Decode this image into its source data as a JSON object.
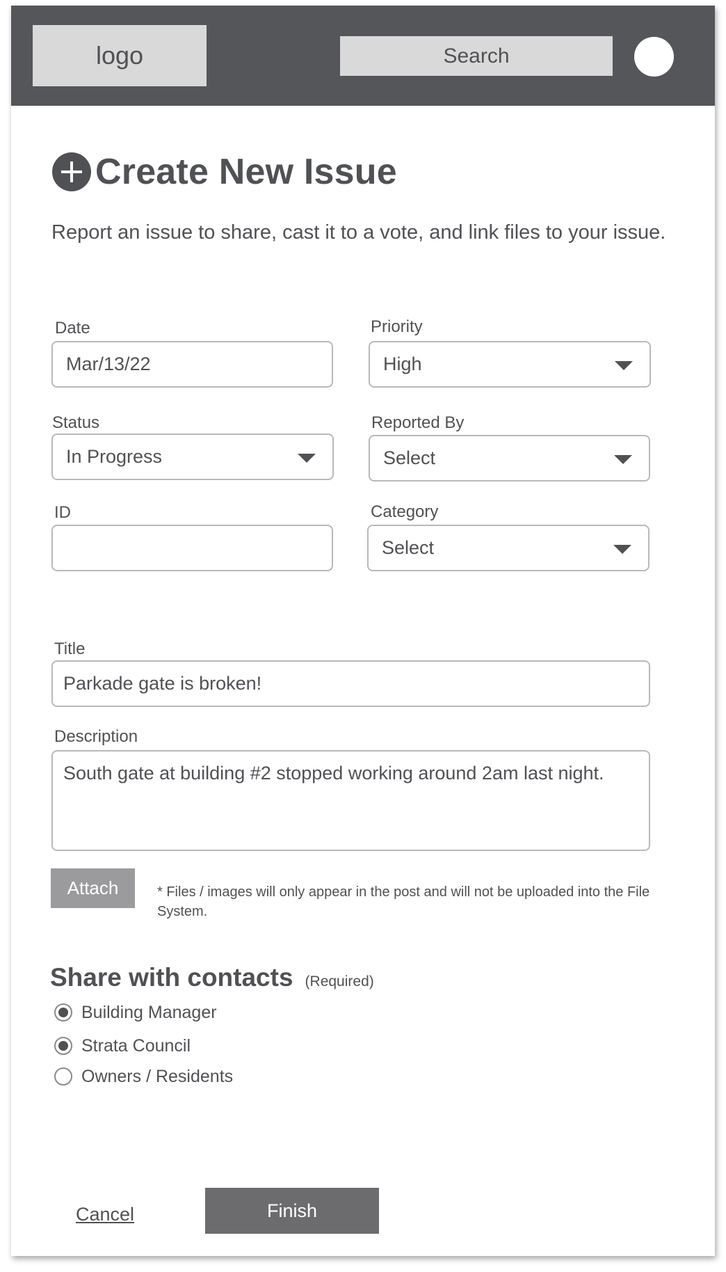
{
  "header": {
    "logo_text": "logo",
    "search_label": "Search"
  },
  "page": {
    "title": "Create New Issue",
    "subtitle": "Report an issue to share, cast it to a vote, and link files to your issue."
  },
  "form": {
    "date": {
      "label": "Date",
      "value": "Mar/13/22"
    },
    "priority": {
      "label": "Priority",
      "value": "High"
    },
    "status": {
      "label": "Status",
      "value": "In Progress"
    },
    "reported_by": {
      "label": "Reported By",
      "value": "Select"
    },
    "id": {
      "label": "ID",
      "value": ""
    },
    "category": {
      "label": "Category",
      "value": "Select"
    },
    "title": {
      "label": "Title",
      "value": "Parkade gate is broken!"
    },
    "description": {
      "label": "Description",
      "value": "South gate at building #2 stopped working around 2am last night."
    }
  },
  "attach": {
    "button_label": "Attach",
    "note": "* Files / images will only appear in the post and will not be uploaded into the File System."
  },
  "share": {
    "heading": "Share with contacts",
    "required_label": "(Required)",
    "options": [
      {
        "label": "Building Manager",
        "checked": true
      },
      {
        "label": "Strata Council",
        "checked": true
      },
      {
        "label": "Owners / Residents",
        "checked": false
      }
    ]
  },
  "actions": {
    "cancel_label": "Cancel",
    "finish_label": "Finish"
  },
  "colors": {
    "header_bg": "#55565a",
    "text": "#505154",
    "placeholder_block": "#d9d9d9",
    "attach_bg": "#9b9b9d",
    "finish_bg": "#6c6c6f",
    "field_border": "#b9b9bb"
  }
}
